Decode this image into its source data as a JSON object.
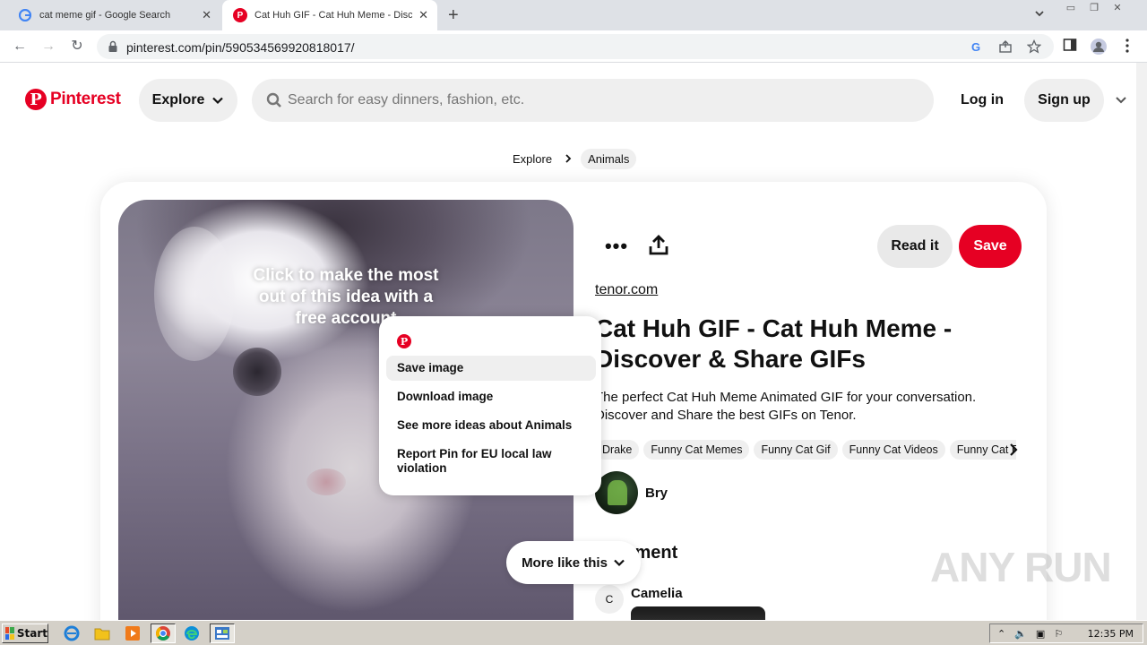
{
  "browser": {
    "tabs": [
      {
        "title": "cat meme gif - Google Search",
        "active": false
      },
      {
        "title": "Cat Huh GIF - Cat Huh Meme - Disco",
        "active": true
      }
    ],
    "url": "pinterest.com/pin/590534569920818017/"
  },
  "header": {
    "logo_text": "Pinterest",
    "explore_label": "Explore",
    "search_placeholder": "Search for easy dinners, fashion, etc.",
    "login_label": "Log in",
    "signup_label": "Sign up"
  },
  "breadcrumb": {
    "items": [
      "Explore",
      "Animals"
    ]
  },
  "pin": {
    "overlay_cta": "Click to make the most out of this idea with a free account",
    "read_it_label": "Read it",
    "save_label": "Save",
    "source": "tenor.com",
    "title": "Cat Huh GIF - Cat Huh Meme - Discover & Share GIFs",
    "description": "The perfect Cat Huh Meme Animated GIF for your conversation. Discover and Share the best GIFs on Tenor.",
    "tags": [
      "Drake",
      "Funny Cat Memes",
      "Funny Cat Gif",
      "Funny Cat Videos",
      "Funny Cat Pictures"
    ],
    "creator": "Bry",
    "comment_heading": "Comment",
    "commenter_initial": "C",
    "commenter_name": "Camelia"
  },
  "more_like_this_label": "More like this",
  "context_menu": {
    "items": [
      "Save image",
      "Download image",
      "See more ideas about Animals",
      "Report Pin for EU local law violation"
    ]
  },
  "watermark": "ANY RUN",
  "taskbar": {
    "start_label": "Start",
    "clock": "12:35 PM"
  },
  "colors": {
    "brand": "#e60023",
    "chip": "#efefef"
  }
}
